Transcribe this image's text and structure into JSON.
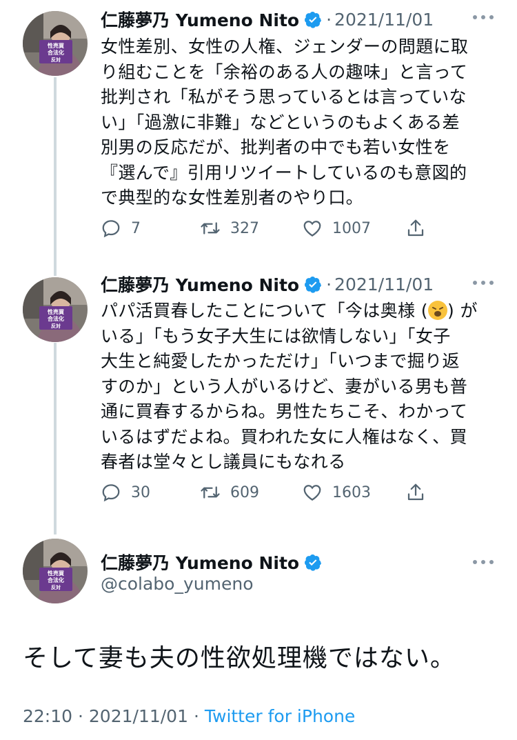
{
  "author": {
    "name": "仁藤夢乃 Yumeno Nito",
    "handle": "@colabo_yumeno"
  },
  "avatar_sign_text": [
    "性売買",
    "合法化",
    "反対"
  ],
  "separator": "·",
  "tweets": [
    {
      "date": "2021/11/01",
      "lines": [
        "女性差別、女性の人権、ジェンダーの問題に取",
        "り組むことを「余裕のある人の趣味」と言って",
        "批判され「私がそう思っているとは言っていな",
        "い」「過激に非難」などというのもよくある差",
        "別男の反応だが、批判者の中でも若い女性を",
        "『選んで』引用リツイートしているのも意図的",
        "で典型的な女性差別者のやり口。"
      ],
      "replies": "7",
      "retweets": "327",
      "likes": "1007"
    },
    {
      "date": "2021/11/01",
      "line1_before": "パパ活買春したことについて「今は奥様 (",
      "line1_after": ") が",
      "lines": [
        "いる」「もう女子大生には欲情しない」「女子",
        "大生と純愛したかっただけ」「いつまで掘り返",
        "すのか」という人がいるけど、妻がいる男も普",
        "通に買春するからね。男性たちこそ、わかって",
        "いるはずだよね。買われた女に人権はなく、買",
        "春者は堂々とし議員にもなれる"
      ],
      "replies": "30",
      "retweets": "609",
      "likes": "1603"
    }
  ],
  "main_tweet": {
    "text": "そして妻も夫の性欲処理機ではない。",
    "time": "22:10",
    "date": "2021/11/01",
    "source": "Twitter for iPhone"
  },
  "icons": {
    "verified": "verified-badge-icon",
    "reply": "reply-icon",
    "retweet": "retweet-icon",
    "like": "heart-icon",
    "share": "share-icon",
    "more": "more-dots-icon",
    "emoji": "weary-face-emoji"
  },
  "colors": {
    "text": "#0f1419",
    "secondary": "#536471",
    "accent": "#1d9bf0",
    "thread_line": "#cfd9de",
    "sign_purple": "#6b3a8f"
  }
}
